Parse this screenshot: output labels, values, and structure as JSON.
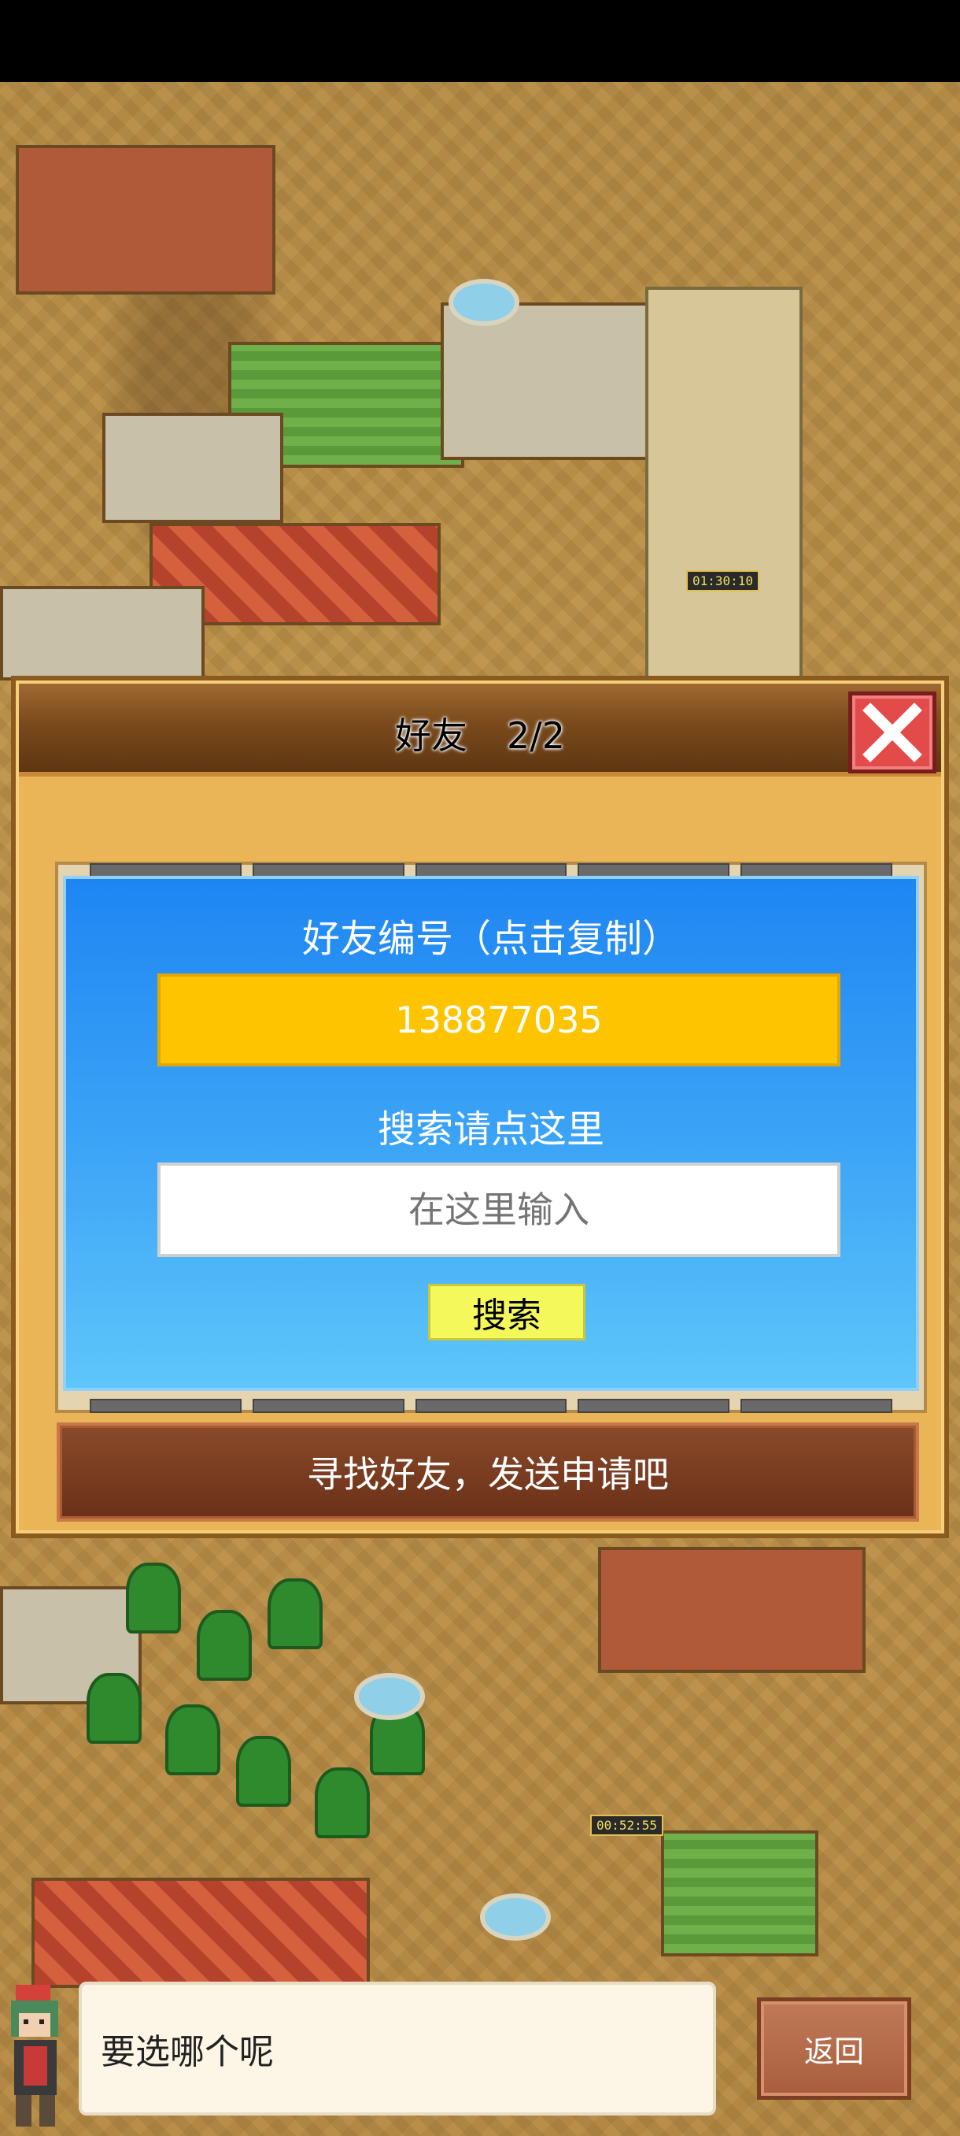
{
  "dialog": {
    "title": "好友",
    "count": "2/2",
    "friend_id_label": "好友编号（点击复制）",
    "friend_id": "138877035",
    "search_label": "搜索请点这里",
    "search_placeholder": "在这里输入",
    "search_button": "搜索",
    "action_button": "寻找好友，发送申请吧"
  },
  "background": {
    "timers": [
      "01:30:10",
      "00:52:55"
    ]
  },
  "footer": {
    "speech_text": "要选哪个呢",
    "back_button": "返回"
  },
  "colors": {
    "id_box": "#ffc400",
    "panel_blue": "#1e86f2",
    "close_red": "#e34a4a",
    "action_brown": "#7a3e22"
  }
}
